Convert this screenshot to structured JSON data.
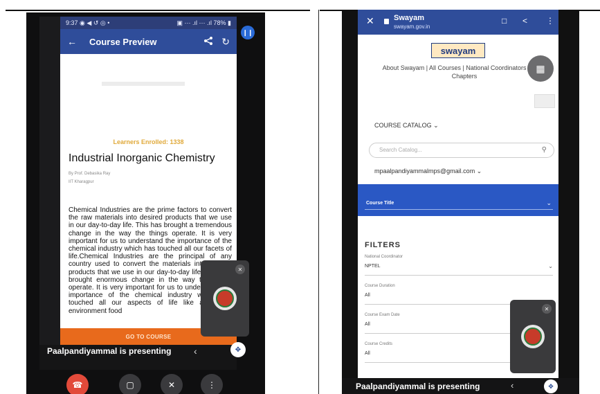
{
  "left": {
    "status": {
      "time": "9:37",
      "indicators": "◉ ◀ ↺ ◎ •",
      "system": "▣ ⋯ .ıl ⋯ .ıl 78% ▮"
    },
    "appbar": {
      "title": "Course Preview",
      "back_icon": "back-arrow-icon",
      "share_icon": "share-icon",
      "refresh_icon": "refresh-icon"
    },
    "enrolled": "Learners Enrolled: 1338",
    "course_title": "Industrial Inorganic Chemistry",
    "instructor": "By Prof. Debasika Ray",
    "institute": "IIT Kharagpur",
    "description": "Chemical Industries are the prime factors to convert the raw materials into desired products that we use in our day-to-day life. This has brought a tremendous change in the way the things operate. It is very important for us to understand the importance of the chemical industry which has touched all our facets of life.Chemical Industries are the principal of any country used to convert the materials into desired products that we use in our day-to-day life. This has brought enormous change in the way the things operate. It is very important for us to understand the importance of the chemical industry which has touched all our aspects of life like agriculture environment food",
    "go_button": "GO TO COURSE",
    "presenting": "Paalpandiyammal is presenting",
    "presenting_short": "Paalpandiyammal is presenting"
  },
  "right": {
    "browser": {
      "site": "Swayam",
      "url": "swayam.gov.in"
    },
    "logo": "swayam",
    "nav_links": "About Swayam | All Courses | National Coordinators | Local Chapters",
    "catalog": "COURSE CATALOG ⌄",
    "search_placeholder": "Search Catalog...",
    "email": "mpaalpandiyammalmps@gmail.com ⌄",
    "course_title_label": "Course Title",
    "filters_heading": "FILTERS",
    "filters": [
      {
        "label": "National Coordinator",
        "value": "NPTEL"
      },
      {
        "label": "Course Duration",
        "value": "All"
      },
      {
        "label": "Course Exam Date",
        "value": "All"
      },
      {
        "label": "Course Credits",
        "value": "All"
      }
    ],
    "presenting": "Paalpandiyammal is presenting"
  },
  "colors": {
    "accent": "#2f4d9a",
    "go": "#e86a1c",
    "end_call": "#e24a3a",
    "course_bar": "#2a58c4"
  }
}
